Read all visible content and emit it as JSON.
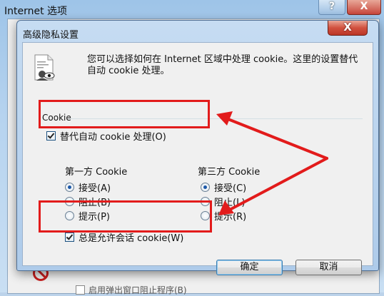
{
  "background_window": {
    "title": "Internet 选项",
    "help_label": "?",
    "close_label": "X",
    "popup_blocker_label": "启用弹出窗口阻止程序(B)"
  },
  "dialog": {
    "title": "高级隐私设置",
    "close_label": "X",
    "description": "您可以选择如何在 Internet 区域中处理 cookie。这里的设置替代自动 cookie 处理。",
    "group_label": "Cookie",
    "override_automatic": {
      "label": "替代自动 cookie 处理(O)",
      "checked": true
    },
    "first_party": {
      "title": "第一方 Cookie",
      "options": [
        "接受(A)",
        "阻止(B)",
        "提示(P)"
      ],
      "selected": "接受(A)"
    },
    "third_party": {
      "title": "第三方 Cookie",
      "options": [
        "接受(C)",
        "阻止(L)",
        "提示(R)"
      ],
      "selected": "接受(C)"
    },
    "session_cookies": {
      "label": "总是允许会话 cookie(W)",
      "checked": true
    },
    "ok_label": "确定",
    "cancel_label": "取消"
  },
  "annotation": {
    "color": "#e21b1b"
  },
  "icons": [
    "help-icon",
    "close-icon",
    "privacy-document-icon",
    "checkmark-icon",
    "radio-icon",
    "blocked-icon",
    "arrow-icon"
  ]
}
